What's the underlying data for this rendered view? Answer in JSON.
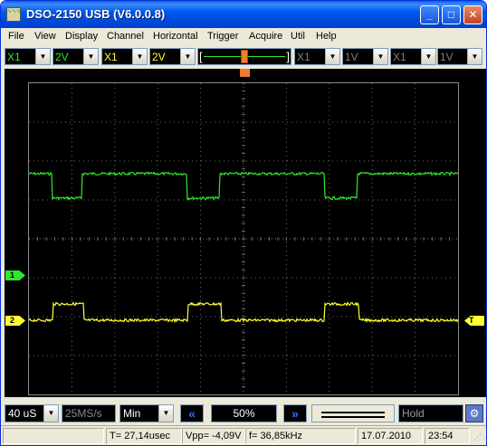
{
  "window": {
    "title": "DSO-2150 USB (V6.0.0.8)",
    "minimize_label": "_",
    "maximize_label": "□",
    "close_label": "✕",
    "icon_text": "∿∿∿"
  },
  "menu": [
    "File",
    "View",
    "Display",
    "Channel",
    "Horizontal",
    "Trigger",
    "Acquire",
    "Util",
    "Help"
  ],
  "toolbar": {
    "ch1_probe": "X1",
    "ch1_volts": "2V",
    "ch2_probe": "X1",
    "ch2_volts": "2V",
    "ch3_probe": "X1",
    "ch3_volts": "1V",
    "ch4_probe": "X1",
    "ch4_volts": "1V",
    "slider_left": "[",
    "slider_right": "]",
    "trigger_position": 0.5
  },
  "scope": {
    "ch1_marker": "1",
    "ch2_marker": "2",
    "trigger_marker": "T",
    "colors": {
      "ch1": "#2ee82e",
      "ch2": "#ffff33",
      "grid": "#6a6a6a",
      "trigger": "#f07d2a"
    }
  },
  "controls": {
    "timebase": "40 uS",
    "sample_rate": "25MS/s",
    "mode": "Min",
    "prev_icon": "«",
    "next_icon": "»",
    "position_pct": "50%",
    "hold": "Hold",
    "settings_icon": "⚙"
  },
  "status": {
    "empty": "",
    "period": "T= 27,14usec",
    "vpp": "Vpp= -4,09V",
    "freq": "f= 36,85kHz",
    "date": "17.07.2010",
    "time": "23:54"
  }
}
